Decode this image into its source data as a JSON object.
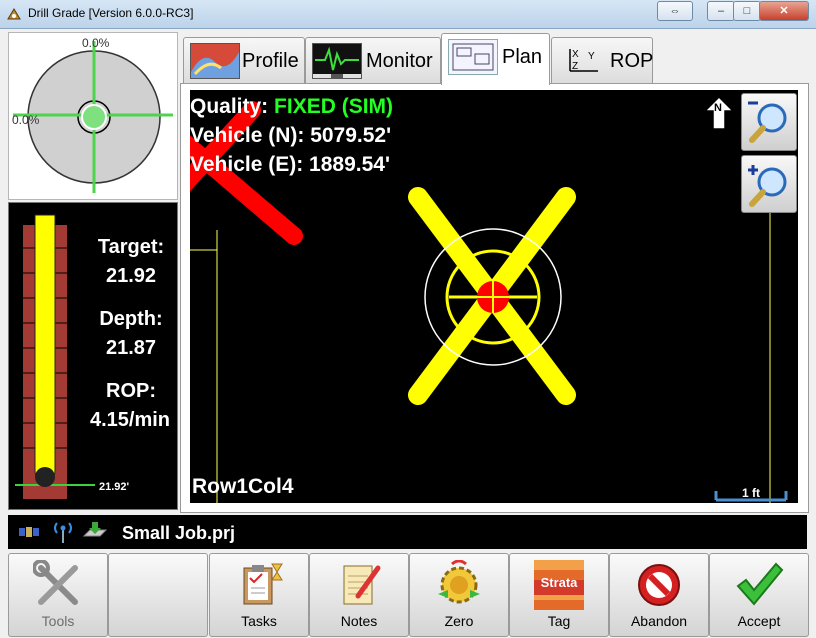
{
  "window": {
    "title": "Drill Grade [Version 6.0.0-RC3]"
  },
  "bubble": {
    "x_label": "0.0%",
    "y_label": "0.0%"
  },
  "gauge": {
    "target_label": "Target:",
    "target_value": "21.92",
    "depth_label": "Depth:",
    "depth_value": "21.87",
    "rop_label": "ROP:",
    "rop_value": "4.15/min",
    "marker_label": "21.92'",
    "fill_fraction": 1.0
  },
  "tabs": [
    {
      "label": "Profile",
      "icon": "profile-chart-icon"
    },
    {
      "label": "Monitor",
      "icon": "monitor-waveform-icon"
    },
    {
      "label": "Plan",
      "icon": "plan-map-icon"
    },
    {
      "label": "ROP",
      "icon": "xyz-axes-icon"
    }
  ],
  "active_tab": "Plan",
  "plan": {
    "quality_label": "Quality:",
    "quality_value": "FIXED (SIM)",
    "vehicle_n": "Vehicle (N): 5079.52'",
    "vehicle_e": "Vehicle (E): 1889.54'",
    "hole_name": "Row1Col4",
    "scale_label": "1 ft",
    "north_label": "N",
    "colors": {
      "quality_fixed": "#22ff22",
      "target_x": "#ffff00",
      "vehicle_x": "#ff0000"
    }
  },
  "status": {
    "project": "Small Job.prj",
    "icons": [
      "gps-satellite-icon",
      "radio-signal-icon",
      "download-tray-icon"
    ]
  },
  "buttons": [
    {
      "label": "Tools",
      "icon": "tools-wrench-icon",
      "enabled": false
    },
    {
      "label": "",
      "icon": "",
      "enabled": false
    },
    {
      "label": "Tasks",
      "icon": "clipboard-hourglass-icon",
      "enabled": true
    },
    {
      "label": "Notes",
      "icon": "notepad-pencil-icon",
      "enabled": true
    },
    {
      "label": "Zero",
      "icon": "zero-gear-icon",
      "enabled": true
    },
    {
      "label": "Tag",
      "icon": "strata-tag-icon",
      "enabled": true,
      "badge": "Strata"
    },
    {
      "label": "Abandon",
      "icon": "no-entry-icon",
      "enabled": true
    },
    {
      "label": "Accept",
      "icon": "checkmark-icon",
      "enabled": true
    }
  ]
}
